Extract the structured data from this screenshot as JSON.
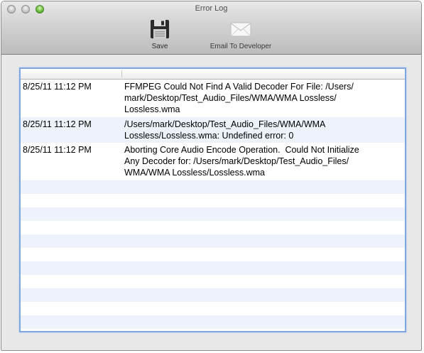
{
  "window": {
    "title": "Error Log"
  },
  "toolbar": {
    "save_label": "Save",
    "email_label": "Email To Developer"
  },
  "log": {
    "rows": [
      {
        "time": "8/25/11 11:12 PM",
        "message": "FFMPEG Could Not Find A Valid Decoder For File: /Users/\nmark/Desktop/Test_Audio_Files/WMA/WMA Lossless/\nLossless.wma"
      },
      {
        "time": "8/25/11 11:12 PM",
        "message": "/Users/mark/Desktop/Test_Audio_Files/WMA/WMA\nLossless/Lossless.wma: Undefined error: 0"
      },
      {
        "time": "8/25/11 11:12 PM",
        "message": "Aborting Core Audio Encode Operation.  Could Not Initialize\nAny Decoder for: /Users/mark/Desktop/Test_Audio_Files/\nWMA/WMA Lossless/Lossless.wma"
      }
    ]
  },
  "colors": {
    "focus_ring": "#7ea6e0",
    "alt_row": "#eef3fb"
  }
}
